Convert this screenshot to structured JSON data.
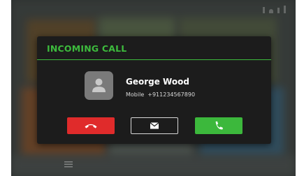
{
  "dialog": {
    "title": "INCOMING CALL",
    "caller": {
      "name": "George Wood",
      "number_label": "Mobile",
      "number": "+911234567890"
    },
    "buttons": [
      {
        "name": "decline-button",
        "icon": "phone-hangup-icon",
        "color": "#e02b2b"
      },
      {
        "name": "message-button",
        "icon": "envelope-icon",
        "color": "transparent"
      },
      {
        "name": "accept-button",
        "icon": "phone-icon",
        "color": "#3cb83c"
      }
    ]
  },
  "theme": {
    "accent": "#3dbb3d",
    "dialog_background": "#1c1c1c",
    "decline": "#e02b2b",
    "accept": "#3cb83c"
  },
  "status_icons": [
    "bluetooth-icon",
    "wifi-icon",
    "signal-icon"
  ]
}
